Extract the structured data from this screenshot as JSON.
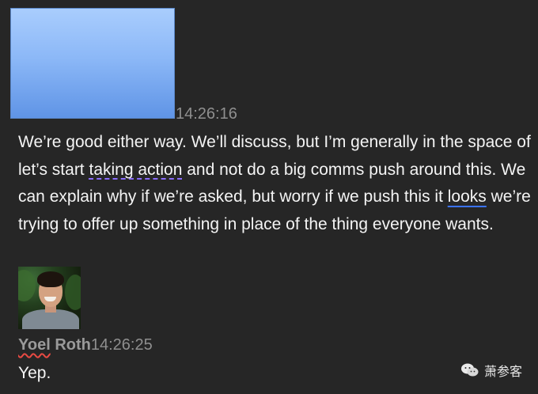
{
  "messages": [
    {
      "timestamp": "14:26:16",
      "text_parts": [
        "We’re good either way. We’ll discuss, but I’m generally in the space of let’s start ",
        "taking action",
        " and not do a big comms push around this. We can explain why if we’re asked, but worry if we push this it ",
        "looks",
        " we’re trying to offer up something in place of the thing everyone wants."
      ]
    },
    {
      "author_first": "Yoel",
      "author_last": " Roth",
      "timestamp": "14:26:25",
      "text": "Yep."
    }
  ],
  "watermark": {
    "icon": "wechat-icon",
    "text": "萧参客"
  },
  "colors": {
    "background": "#262626",
    "text": "#f4f4f4",
    "muted": "#8f8f8f",
    "redaction": "#8cb8f7"
  }
}
